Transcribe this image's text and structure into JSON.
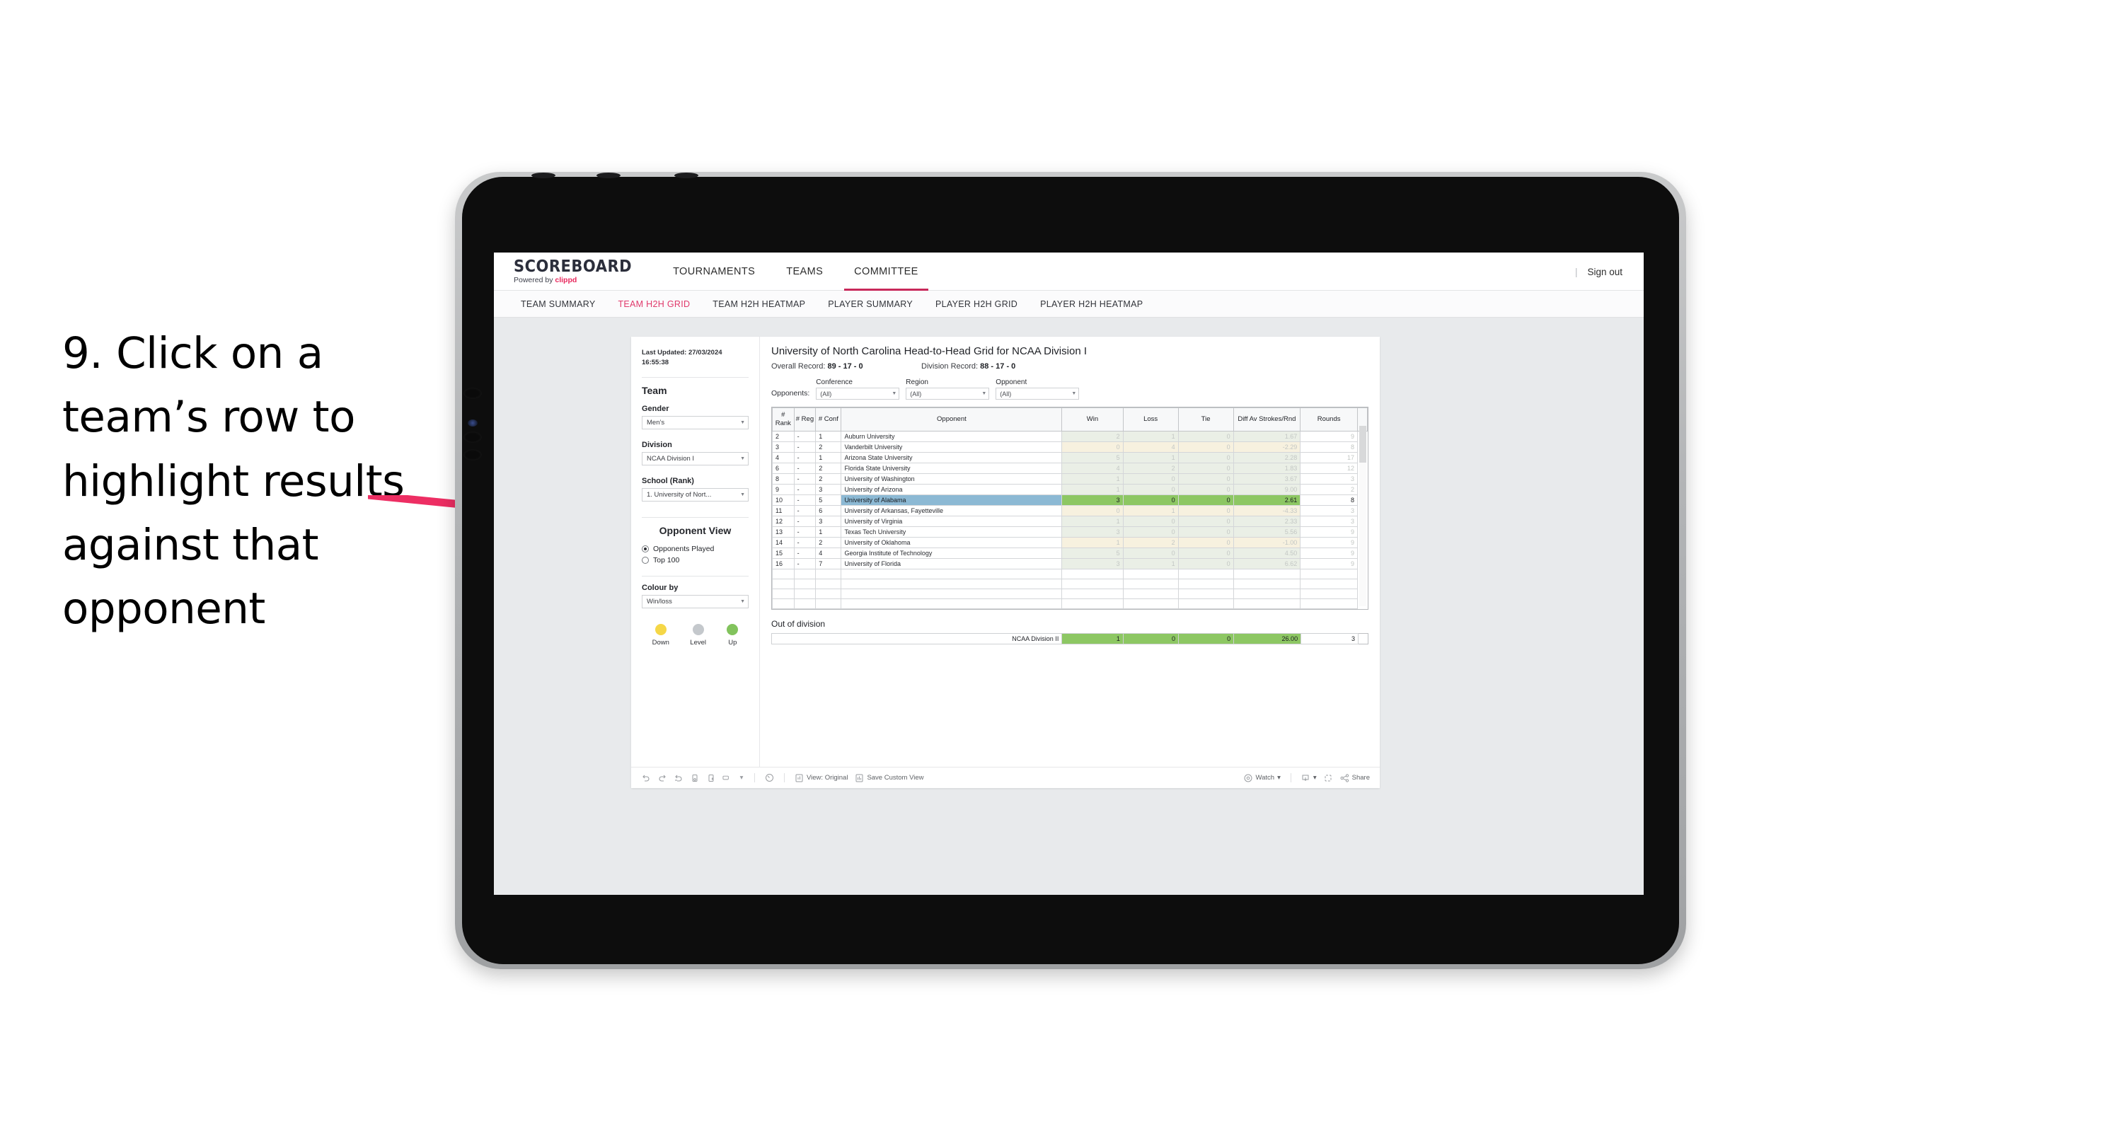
{
  "annotation": {
    "text": "9. Click on a team’s row to highlight results against that opponent",
    "arrow_color": "#ed2e63"
  },
  "topnav": {
    "brand_name": "SCOREBOARD",
    "brand_powered_prefix": "Powered by ",
    "brand_powered_name": "clippd",
    "tabs": [
      {
        "label": "TOURNAMENTS",
        "active": false
      },
      {
        "label": "TEAMS",
        "active": false
      },
      {
        "label": "COMMITTEE",
        "active": true
      }
    ],
    "divider": "|",
    "sign_out": "Sign out"
  },
  "subnav": {
    "items": [
      {
        "label": "TEAM SUMMARY",
        "active": false
      },
      {
        "label": "TEAM H2H GRID",
        "active": true
      },
      {
        "label": "TEAM H2H HEATMAP",
        "active": false
      },
      {
        "label": "PLAYER SUMMARY",
        "active": false
      },
      {
        "label": "PLAYER H2H GRID",
        "active": false
      },
      {
        "label": "PLAYER H2H HEATMAP",
        "active": false
      }
    ]
  },
  "sidebar": {
    "last_updated": "Last Updated: 27/03/2024 16:55:38",
    "team_heading": "Team",
    "gender_label": "Gender",
    "gender_value": "Men’s",
    "division_label": "Division",
    "division_value": "NCAA Division I",
    "school_label": "School (Rank)",
    "school_value": "1. University of Nort...",
    "opponent_view_heading": "Opponent View",
    "opponent_view_options": [
      {
        "label": "Opponents Played",
        "selected": true
      },
      {
        "label": "Top 100",
        "selected": false
      }
    ],
    "colour_by_label": "Colour by",
    "colour_by_value": "Win/loss",
    "legend": [
      {
        "label": "Down",
        "color": "#f5d747"
      },
      {
        "label": "Level",
        "color": "#c4c8cc"
      },
      {
        "label": "Up",
        "color": "#82c35d"
      }
    ]
  },
  "panel": {
    "title": "University of North Carolina Head-to-Head Grid for NCAA Division I",
    "overall_record_label": "Overall Record: ",
    "overall_record_value": "89 - 17 - 0",
    "division_record_label": "Division Record: ",
    "division_record_value": "88 - 17 - 0",
    "opponents_label": "Opponents:",
    "filters": [
      {
        "label": "Conference",
        "value": "(All)"
      },
      {
        "label": "Region",
        "value": "(All)"
      },
      {
        "label": "Opponent",
        "value": "(All)"
      }
    ],
    "out_of_division_title": "Out of division"
  },
  "chart_data": {
    "type": "table",
    "title": "University of North Carolina Head-to-Head Grid for NCAA Division I",
    "columns": [
      "# Rank",
      "# Reg",
      "# Conf",
      "Opponent",
      "Win",
      "Loss",
      "Tie",
      "Diff Av Strokes/Rnd",
      "Rounds"
    ],
    "selected_row": "University of Alabama",
    "rows": [
      {
        "rank": "2",
        "reg": "-",
        "conf": "1",
        "opponent": "Auburn University",
        "win": "2",
        "loss": "1",
        "tie": "0",
        "diff": "1.67",
        "rounds": "9",
        "result": "win",
        "selected": false
      },
      {
        "rank": "3",
        "reg": "-",
        "conf": "2",
        "opponent": "Vanderbilt University",
        "win": "0",
        "loss": "4",
        "tie": "0",
        "diff": "-2.29",
        "rounds": "8",
        "result": "loss",
        "selected": false
      },
      {
        "rank": "4",
        "reg": "-",
        "conf": "1",
        "opponent": "Arizona State University",
        "win": "5",
        "loss": "1",
        "tie": "0",
        "diff": "2.28",
        "rounds": "17",
        "result": "win",
        "selected": false
      },
      {
        "rank": "6",
        "reg": "-",
        "conf": "2",
        "opponent": "Florida State University",
        "win": "4",
        "loss": "2",
        "tie": "0",
        "diff": "1.83",
        "rounds": "12",
        "result": "win",
        "selected": false
      },
      {
        "rank": "8",
        "reg": "-",
        "conf": "2",
        "opponent": "University of Washington",
        "win": "1",
        "loss": "0",
        "tie": "0",
        "diff": "3.67",
        "rounds": "3",
        "result": "win",
        "selected": false
      },
      {
        "rank": "9",
        "reg": "-",
        "conf": "3",
        "opponent": "University of Arizona",
        "win": "1",
        "loss": "0",
        "tie": "0",
        "diff": "9.00",
        "rounds": "2",
        "result": "win",
        "selected": false
      },
      {
        "rank": "10",
        "reg": "-",
        "conf": "5",
        "opponent": "University of Alabama",
        "win": "3",
        "loss": "0",
        "tie": "0",
        "diff": "2.61",
        "rounds": "8",
        "result": "win",
        "selected": true
      },
      {
        "rank": "11",
        "reg": "-",
        "conf": "6",
        "opponent": "University of Arkansas, Fayetteville",
        "win": "0",
        "loss": "1",
        "tie": "0",
        "diff": "-4.33",
        "rounds": "3",
        "result": "loss",
        "selected": false
      },
      {
        "rank": "12",
        "reg": "-",
        "conf": "3",
        "opponent": "University of Virginia",
        "win": "1",
        "loss": "0",
        "tie": "0",
        "diff": "2.33",
        "rounds": "3",
        "result": "win",
        "selected": false
      },
      {
        "rank": "13",
        "reg": "-",
        "conf": "1",
        "opponent": "Texas Tech University",
        "win": "3",
        "loss": "0",
        "tie": "0",
        "diff": "5.56",
        "rounds": "9",
        "result": "win",
        "selected": false
      },
      {
        "rank": "14",
        "reg": "-",
        "conf": "2",
        "opponent": "University of Oklahoma",
        "win": "1",
        "loss": "2",
        "tie": "0",
        "diff": "-1.00",
        "rounds": "9",
        "result": "loss",
        "selected": false
      },
      {
        "rank": "15",
        "reg": "-",
        "conf": "4",
        "opponent": "Georgia Institute of Technology",
        "win": "5",
        "loss": "0",
        "tie": "0",
        "diff": "4.50",
        "rounds": "9",
        "result": "win",
        "selected": false
      },
      {
        "rank": "16",
        "reg": "-",
        "conf": "7",
        "opponent": "University of Florida",
        "win": "3",
        "loss": "1",
        "tie": "0",
        "diff": "6.62",
        "rounds": "9",
        "result": "win",
        "selected": false
      }
    ],
    "out_of_division": {
      "label": "NCAA Division II",
      "win": "1",
      "loss": "0",
      "tie": "0",
      "diff": "26.00",
      "rounds": "3"
    }
  },
  "toolbar": {
    "view_label": "View: Original",
    "save_label": "Save Custom View",
    "watch_label": "Watch",
    "share_label": "Share"
  }
}
